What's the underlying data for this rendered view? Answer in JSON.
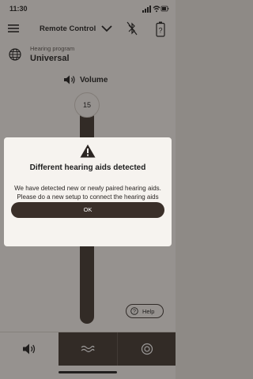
{
  "status_bar": {
    "time": "11:30"
  },
  "header": {
    "title": "Remote Control"
  },
  "program": {
    "label": "Hearing program",
    "name": "Universal"
  },
  "volume": {
    "label": "Volume",
    "value": "15"
  },
  "help": {
    "label": "Help"
  },
  "tabs": [
    {
      "icon": "speaker-icon",
      "selected": true
    },
    {
      "icon": "sound-wave-icon",
      "selected": false
    },
    {
      "icon": "target-icon",
      "selected": false
    }
  ],
  "dialog": {
    "title": "Different hearing aids detected",
    "message": "We have detected new or newly paired hearing aids. Please do a new setup to connect the hearing aids with the app.",
    "ok_label": "OK"
  },
  "colors": {
    "accent": "#3f352f",
    "background": "#f4f1ed",
    "overlay": "#231e1c"
  }
}
